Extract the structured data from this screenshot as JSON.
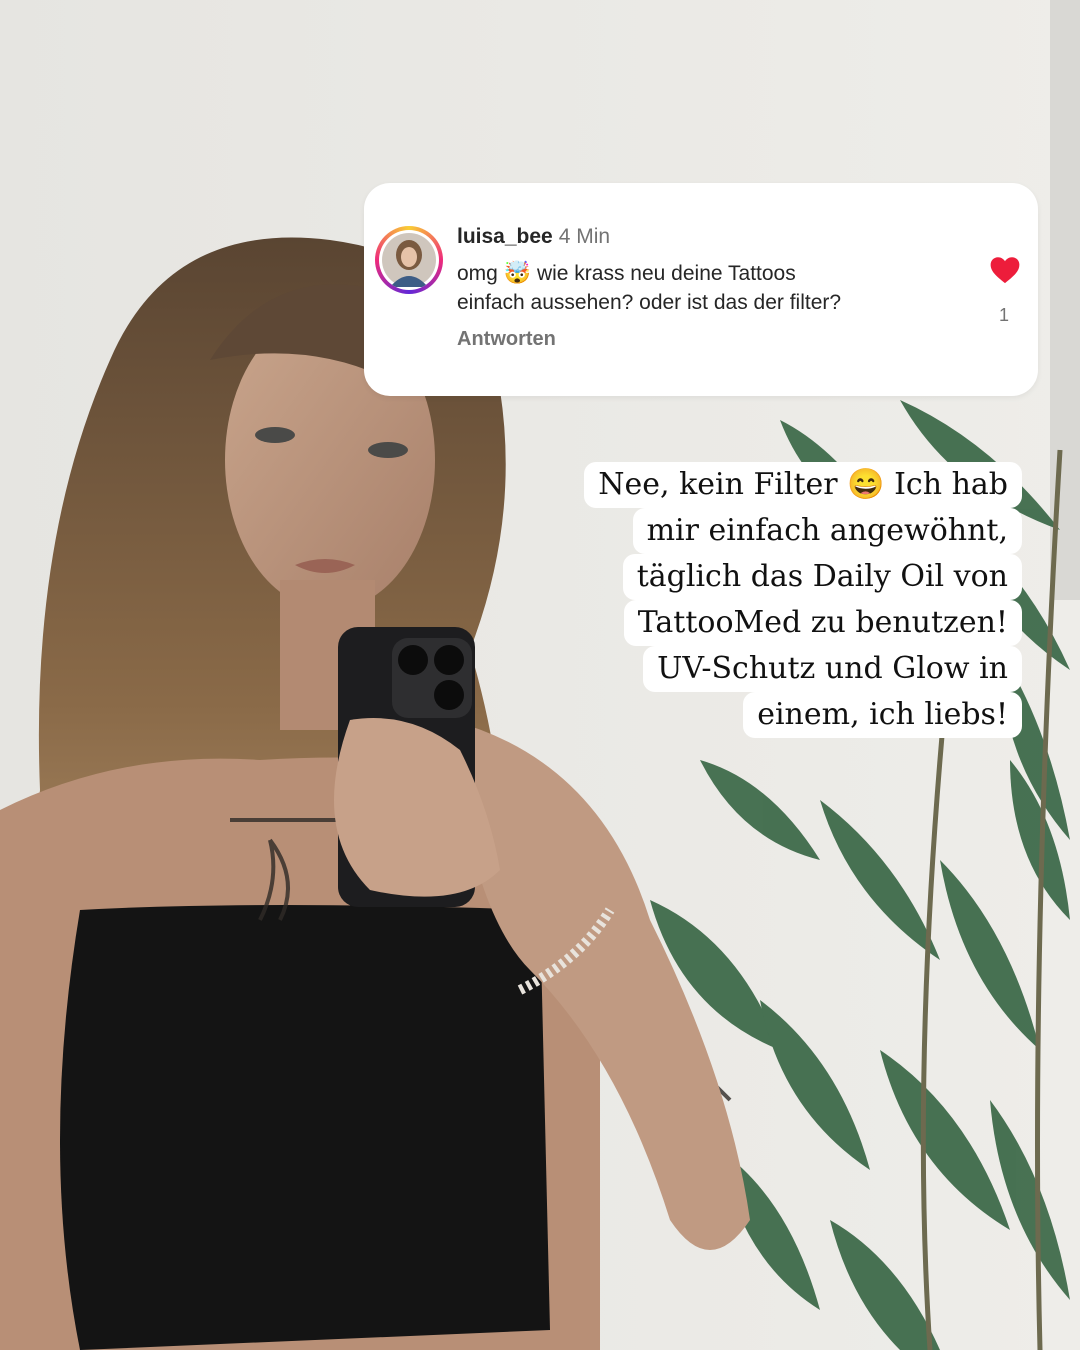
{
  "comment": {
    "username": "luisa_bee",
    "time": "4 Min",
    "text_line1_a": "omg",
    "text_emoji": "🤯",
    "text_line1_b": "wie krass neu deine Tattoos",
    "text_line2": "einfach aussehen? oder ist das der filter?",
    "reply_label": "Antworten",
    "like_count": "1",
    "like_icon": "heart-icon",
    "like_color": "#ed1d3b"
  },
  "reply": {
    "lines": [
      "Nee, kein Filter 😄 Ich hab",
      "mir einfach angewöhnt,",
      "täglich das Daily Oil von",
      "TattooMed zu benutzen!",
      "UV-Schutz und Glow in",
      "einem, ich liebs!"
    ]
  }
}
